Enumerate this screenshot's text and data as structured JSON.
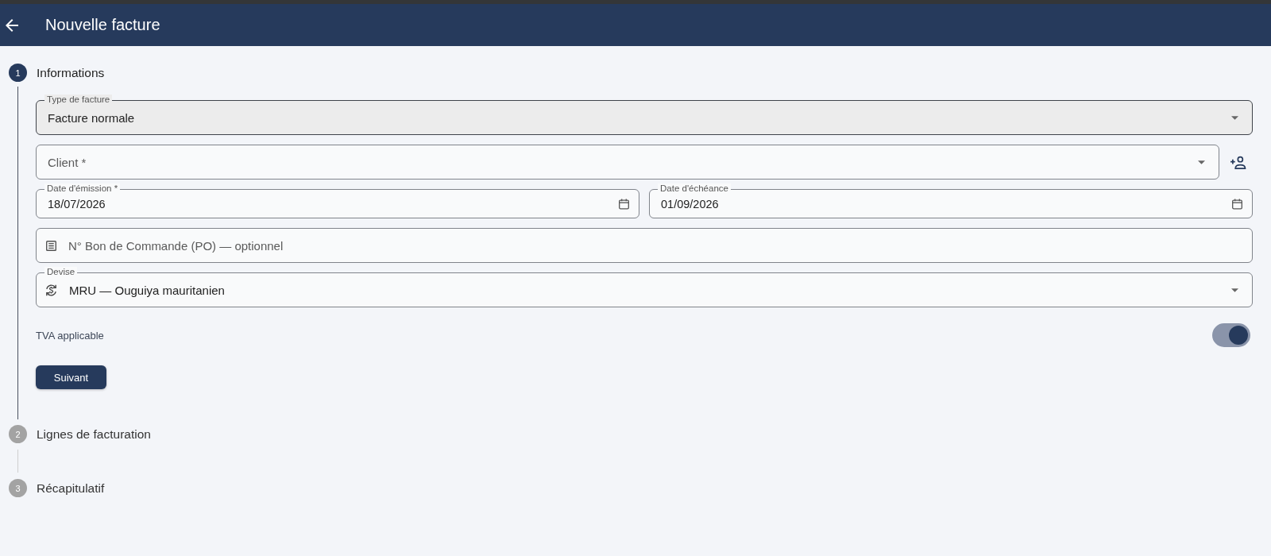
{
  "app_bar": {
    "title": "Nouvelle facture"
  },
  "steps": [
    {
      "number": "1",
      "label": "Informations",
      "selected": true
    },
    {
      "number": "2",
      "label": "Lignes de facturation",
      "selected": false
    },
    {
      "number": "3",
      "label": "Récapitulatif",
      "selected": false
    }
  ],
  "form": {
    "rows": [
      {
        "fields": [
          {
            "kind": "select",
            "label": "Type de facture",
            "value": "Facture normale",
            "readonly": true
          }
        ]
      },
      {
        "fields": [
          {
            "kind": "lookup",
            "placeholder": "Client *",
            "readonly": false
          }
        ]
      },
      {
        "fields": [
          {
            "kind": "date",
            "label": "Date d'émission *",
            "value": "18/07/2026",
            "readonly": false
          },
          {
            "kind": "date",
            "label": "Date d'échéance",
            "value": "01/09/2026",
            "readonly": false
          }
        ]
      },
      {
        "fields": [
          {
            "kind": "reference",
            "placeholder": "N° Bon de Commande (PO) — optionnel",
            "readonly": false
          }
        ]
      },
      {
        "fields": [
          {
            "kind": "currency",
            "label": "Devise",
            "value": "MRU — Ouguiya mauritanien",
            "readonly": false
          }
        ]
      }
    ],
    "toggle": {
      "label": "TVA applicable",
      "on": true
    },
    "next_button": {
      "label": "Suivant"
    }
  }
}
